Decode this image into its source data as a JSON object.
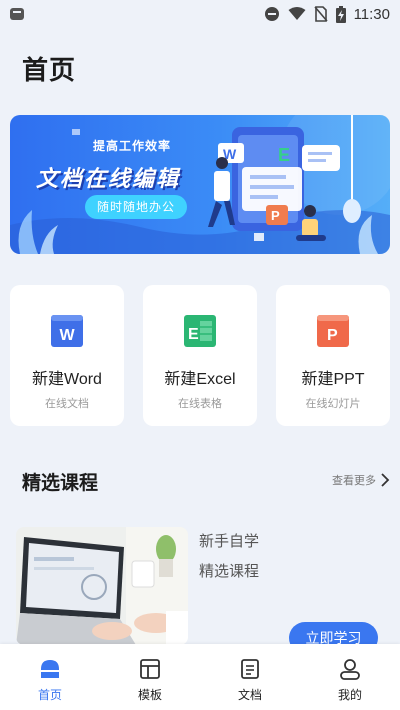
{
  "status_bar": {
    "time": "11:30"
  },
  "page": {
    "title": "首页"
  },
  "banner": {
    "subtitle": "提高工作效率",
    "title": "文档在线编辑",
    "pill": "随时随地办公"
  },
  "cards": [
    {
      "label": "新建Word",
      "sub": "在线文档",
      "icon": "word-icon",
      "letter": "W",
      "color": "#3f6fe8"
    },
    {
      "label": "新建Excel",
      "sub": "在线表格",
      "icon": "excel-icon",
      "letter": "E",
      "color": "#2bb673"
    },
    {
      "label": "新建PPT",
      "sub": "在线幻灯片",
      "icon": "ppt-icon",
      "letter": "P",
      "color": "#f0694a"
    }
  ],
  "section": {
    "title": "精选课程",
    "more": "查看更多"
  },
  "course": {
    "line1": "新手自学",
    "line2": "精选课程",
    "button": "立即学习"
  },
  "nav": [
    {
      "label": "首页",
      "icon": "home-icon",
      "active": true
    },
    {
      "label": "模板",
      "icon": "template-icon",
      "active": false
    },
    {
      "label": "文档",
      "icon": "document-icon",
      "active": false
    },
    {
      "label": "我的",
      "icon": "profile-icon",
      "active": false
    }
  ],
  "colors": {
    "accent": "#3a77f0",
    "background": "#eef2f9"
  }
}
